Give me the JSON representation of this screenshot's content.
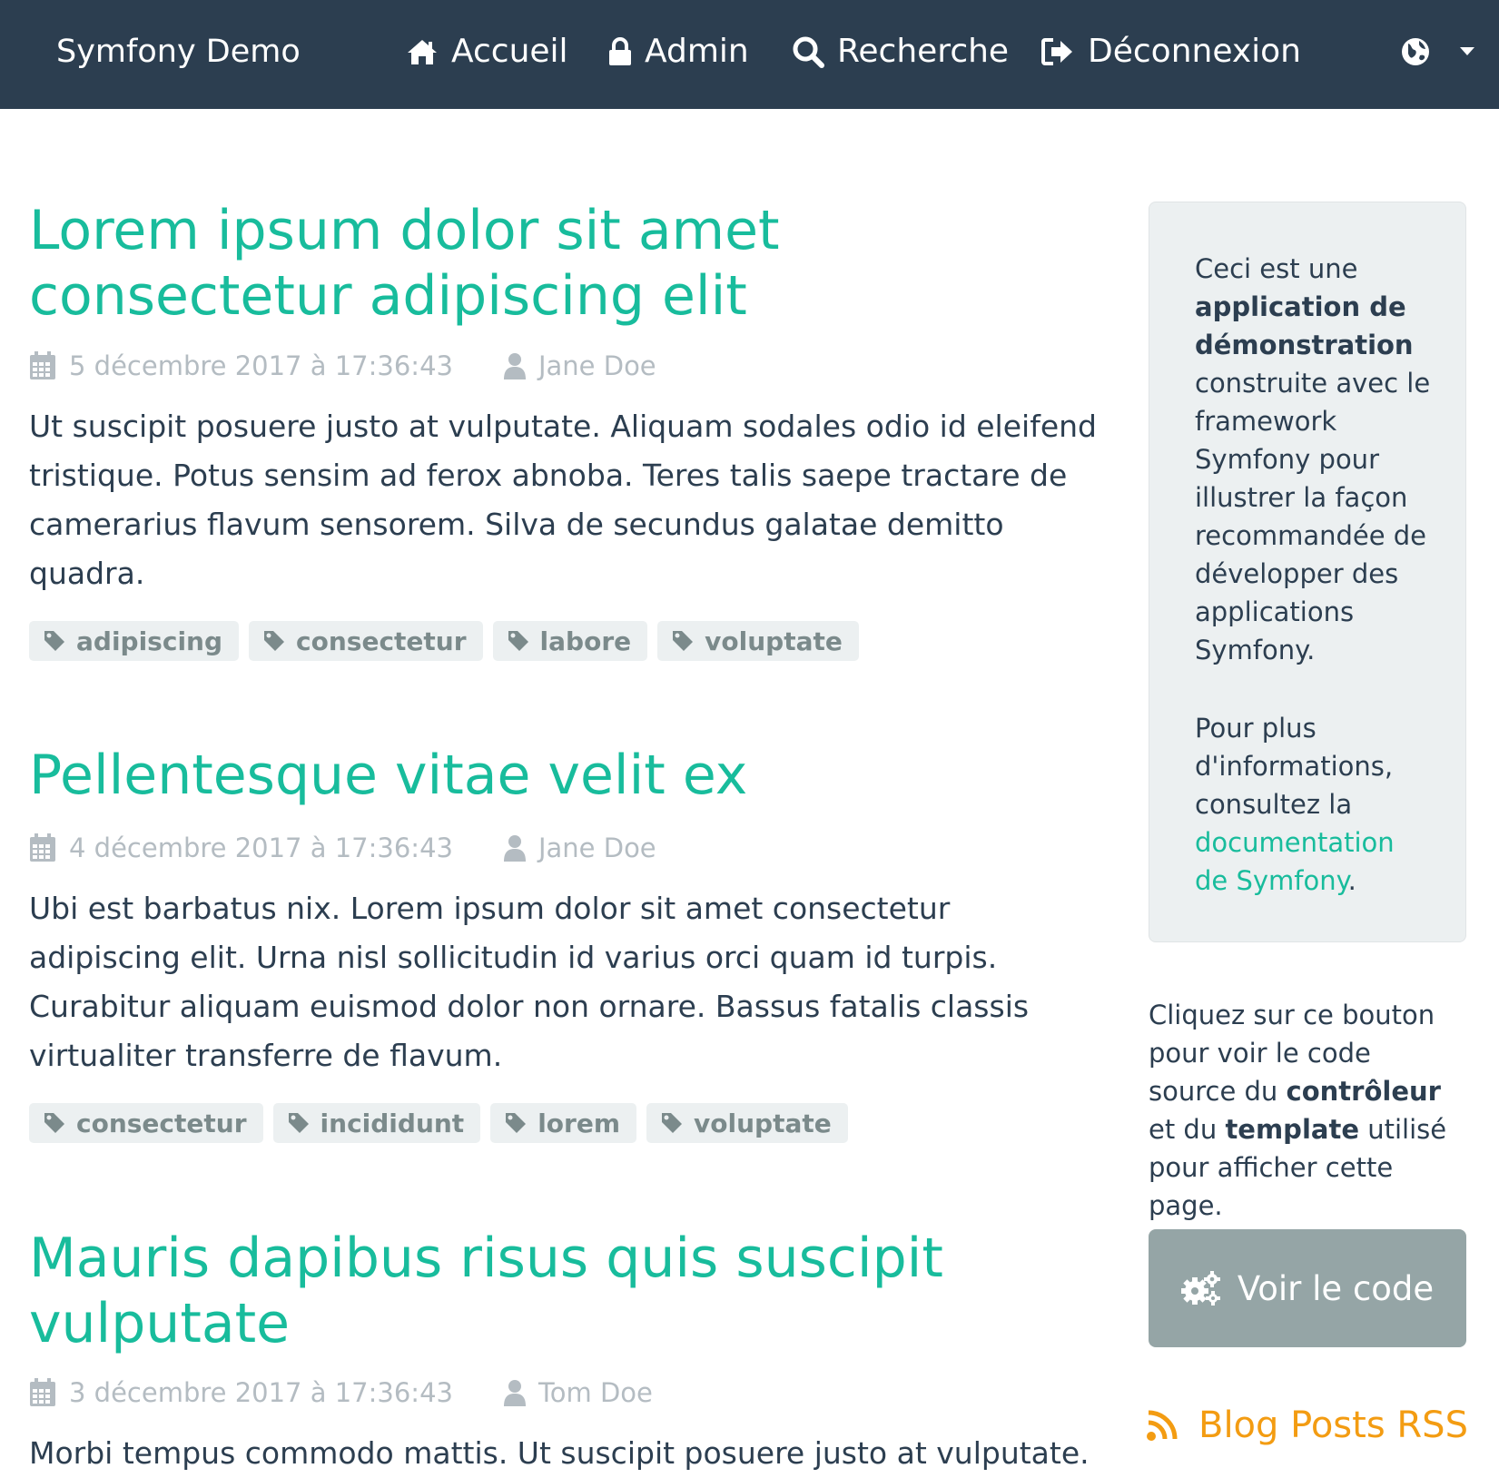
{
  "nav": {
    "brand": "Symfony Demo",
    "items": [
      {
        "label": "Accueil",
        "icon": "home-icon"
      },
      {
        "label": "Admin",
        "icon": "lock-icon"
      },
      {
        "label": "Recherche",
        "icon": "search-icon"
      },
      {
        "label": "Déconnexion",
        "icon": "sign-out-icon"
      }
    ],
    "language_icon": "globe-icon"
  },
  "posts": [
    {
      "title": "Lorem ipsum dolor sit amet consectetur adipiscing elit",
      "date": "5 décembre 2017 à 17:36:43",
      "author": "Jane Doe",
      "summary": "Ut suscipit posuere justo at vulputate. Aliquam sodales odio id eleifend tristique. Potus sensim ad ferox abnoba. Teres talis saepe tractare de camerarius flavum sensorem. Silva de secundus galatae demitto quadra.",
      "tags": [
        "adipiscing",
        "consectetur",
        "labore",
        "voluptate"
      ]
    },
    {
      "title": "Pellentesque vitae velit ex",
      "date": "4 décembre 2017 à 17:36:43",
      "author": "Jane Doe",
      "summary": "Ubi est barbatus nix. Lorem ipsum dolor sit amet consectetur adipiscing elit. Urna nisl sollicitudin id varius orci quam id turpis. Curabitur aliquam euismod dolor non ornare. Bassus fatalis classis virtualiter transferre de flavum.",
      "tags": [
        "consectetur",
        "incididunt",
        "lorem",
        "voluptate"
      ]
    },
    {
      "title": "Mauris dapibus risus quis suscipit vulputate",
      "date": "3 décembre 2017 à 17:36:43",
      "author": "Tom Doe",
      "summary": "Morbi tempus commodo mattis. Ut suscipit posuere justo at vulputate."
    }
  ],
  "sidebar": {
    "intro": {
      "before": "Ceci est une ",
      "bold": "application de démonstration",
      "after": " construite avec le framework Symfony pour illustrer la façon recommandée de développer des applications Symfony."
    },
    "more_info": {
      "before": "Pour plus d'informations, consultez la ",
      "link": "documentation de Symfony",
      "after": "."
    },
    "source_help": {
      "part1": "Cliquez sur ce bouton pour voir le code source du ",
      "bold1": "contrôleur",
      "part2": " et du ",
      "bold2": "template",
      "part3": " utilisé pour afficher cette page."
    },
    "code_button": "Voir le code",
    "rss_link": "Blog Posts RSS"
  },
  "colors": {
    "navbar": "#2c3e50",
    "accent": "#18bc9c",
    "muted": "#b4bcc2",
    "tag_bg": "#ecf0f1",
    "button": "#95a5a6",
    "rss": "#f39c12"
  }
}
